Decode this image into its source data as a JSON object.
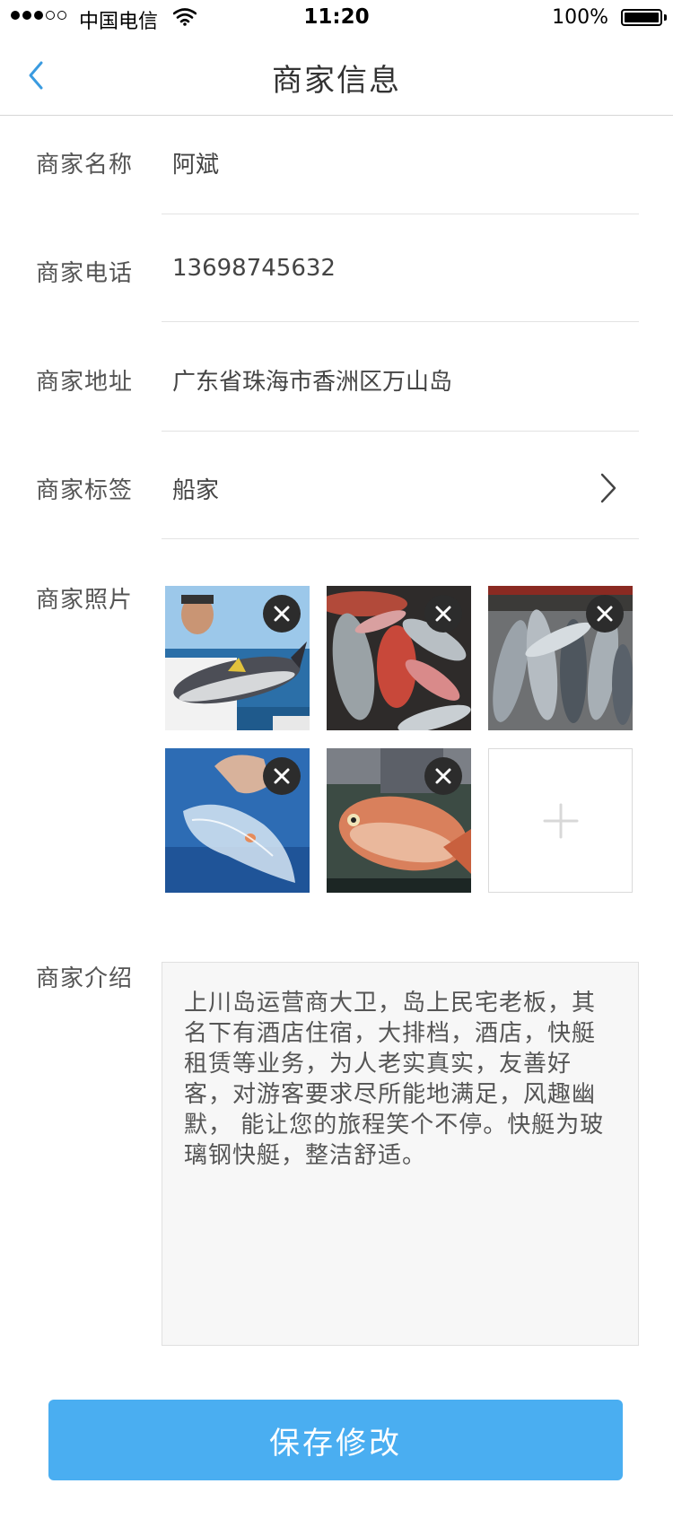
{
  "status_bar": {
    "carrier": "中国电信",
    "time": "11:20",
    "battery": "100%"
  },
  "nav": {
    "title": "商家信息"
  },
  "form": {
    "name": {
      "label": "商家名称",
      "value": "阿斌"
    },
    "phone": {
      "label": "商家电话",
      "value": "13698745632"
    },
    "address": {
      "label": "商家地址",
      "value": "广东省珠海市香洲区万山岛"
    },
    "tag": {
      "label": "商家标签",
      "value": "船家"
    },
    "photos": {
      "label": "商家照片"
    },
    "intro": {
      "label": "商家介绍",
      "value": "上川岛运营商大卫，岛上民宅老板，其名下有酒店住宿，大排档，酒店，快艇租赁等业务，为人老实真实，友善好客，对游客要求尽所能地满足，风趣幽默， 能让您的旅程笑个不停。快艇为玻璃钢快艇，整洁舒适。"
    }
  },
  "save_button": {
    "label": "保存修改"
  },
  "colors": {
    "accent": "#4aaef1",
    "back_arrow": "#3a9be0"
  }
}
